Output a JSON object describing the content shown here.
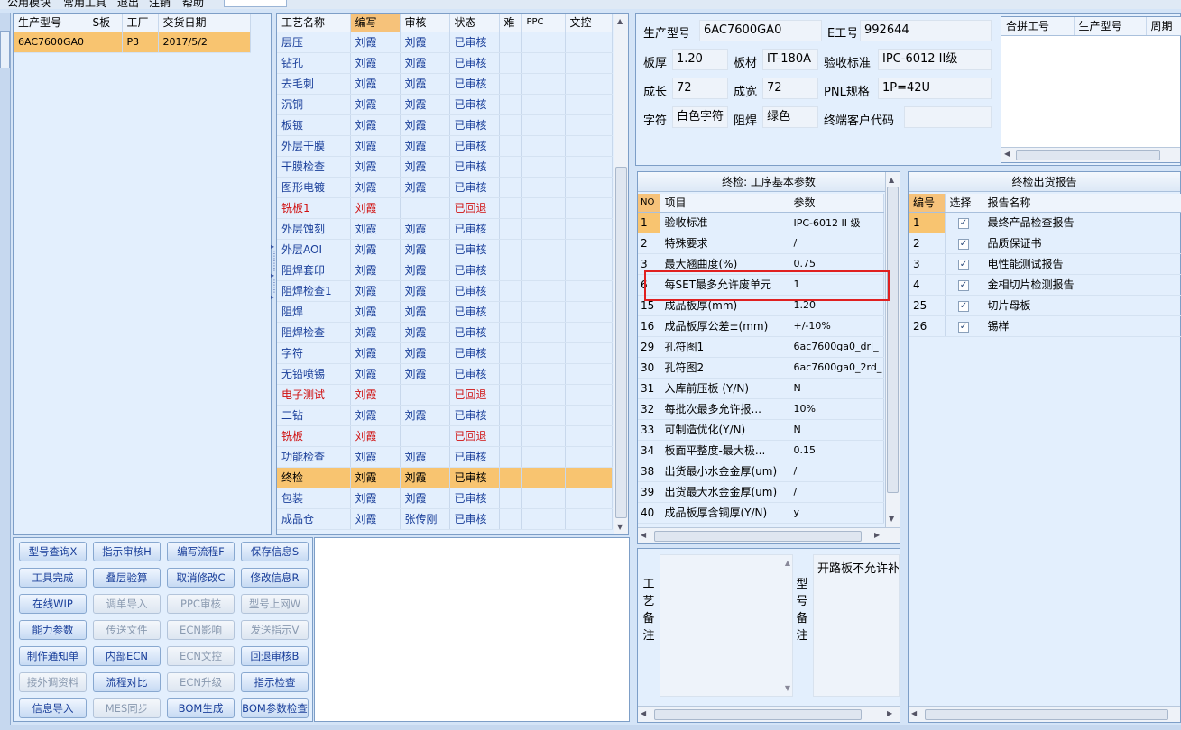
{
  "menu": {
    "items": [
      "公用模块",
      "常用工具",
      "退出",
      "注销",
      "帮助"
    ]
  },
  "left": {
    "headers": [
      "生产型号",
      "S板",
      "工厂",
      "交货日期"
    ],
    "rows": [
      [
        "6AC7600GA0",
        "",
        "P3",
        "2017/5/2"
      ]
    ]
  },
  "process": {
    "headers": [
      "工艺名称",
      "编写",
      "审核",
      "状态",
      "难",
      "PPC",
      "文控"
    ],
    "rows": [
      [
        "层压",
        "刘霞",
        "刘霞",
        "已审核",
        "blue"
      ],
      [
        "钻孔",
        "刘霞",
        "刘霞",
        "已审核",
        "blue"
      ],
      [
        "去毛刺",
        "刘霞",
        "刘霞",
        "已审核",
        "blue"
      ],
      [
        "沉铜",
        "刘霞",
        "刘霞",
        "已审核",
        "blue"
      ],
      [
        "板镀",
        "刘霞",
        "刘霞",
        "已审核",
        "blue"
      ],
      [
        "外层干膜",
        "刘霞",
        "刘霞",
        "已审核",
        "blue"
      ],
      [
        "干膜检查",
        "刘霞",
        "刘霞",
        "已审核",
        "blue"
      ],
      [
        "图形电镀",
        "刘霞",
        "刘霞",
        "已审核",
        "blue"
      ],
      [
        "铣板1",
        "刘霞",
        "",
        "已回退",
        "red"
      ],
      [
        "外层蚀刻",
        "刘霞",
        "刘霞",
        "已审核",
        "blue"
      ],
      [
        "外层AOI",
        "刘霞",
        "刘霞",
        "已审核",
        "blue"
      ],
      [
        "阻焊套印",
        "刘霞",
        "刘霞",
        "已审核",
        "blue"
      ],
      [
        "阻焊检查1",
        "刘霞",
        "刘霞",
        "已审核",
        "blue"
      ],
      [
        "阻焊",
        "刘霞",
        "刘霞",
        "已审核",
        "blue"
      ],
      [
        "阻焊检查",
        "刘霞",
        "刘霞",
        "已审核",
        "blue"
      ],
      [
        "字符",
        "刘霞",
        "刘霞",
        "已审核",
        "blue"
      ],
      [
        "无铅喷锡",
        "刘霞",
        "刘霞",
        "已审核",
        "blue"
      ],
      [
        "电子测试",
        "刘霞",
        "",
        "已回退",
        "red"
      ],
      [
        "二钻",
        "刘霞",
        "刘霞",
        "已审核",
        "blue"
      ],
      [
        "铣板",
        "刘霞",
        "",
        "已回退",
        "red"
      ],
      [
        "功能检查",
        "刘霞",
        "刘霞",
        "已审核",
        "blue"
      ],
      [
        "终检",
        "刘霞",
        "刘霞",
        "已审核",
        "sel"
      ],
      [
        "包装",
        "刘霞",
        "刘霞",
        "已审核",
        "blue"
      ],
      [
        "成品仓",
        "刘霞",
        "张传刚",
        "已审核",
        "blue"
      ]
    ]
  },
  "buttons": [
    [
      "型号查询X",
      "btn"
    ],
    [
      "指示审核H",
      "btn"
    ],
    [
      "编写流程F",
      "btn"
    ],
    [
      "保存信息S",
      "btn"
    ],
    [
      "工具完成",
      "btn"
    ],
    [
      "叠层验算",
      "btn"
    ],
    [
      "取消修改C",
      "btn"
    ],
    [
      "修改信息R",
      "btn"
    ],
    [
      "在线WIP",
      "btn"
    ],
    [
      "调单导入",
      "dis"
    ],
    [
      "PPC审核",
      "dis"
    ],
    [
      "型号上网W",
      "dis"
    ],
    [
      "能力参数",
      "btn"
    ],
    [
      "传送文件",
      "dis"
    ],
    [
      "ECN影响",
      "dis"
    ],
    [
      "发送指示V",
      "dis"
    ],
    [
      "制作通知单",
      "btn"
    ],
    [
      "内部ECN",
      "btn"
    ],
    [
      "ECN文控",
      "dis"
    ],
    [
      "回退审核B",
      "btn"
    ],
    [
      "接外调资料",
      "dis"
    ],
    [
      "流程对比",
      "btn"
    ],
    [
      "ECN升级",
      "dis"
    ],
    [
      "指示检查",
      "btn"
    ],
    [
      "信息导入",
      "btn"
    ],
    [
      "MES同步",
      "dis"
    ],
    [
      "BOM生成",
      "btn"
    ],
    [
      "BOM参数检查",
      "btn"
    ]
  ],
  "info": {
    "model_label": "生产型号",
    "model": "6AC7600GA0",
    "e_label": "E工号",
    "e_no": "992644",
    "thick_label": "板厚",
    "thick": "1.20",
    "mat_label": "板材",
    "mat": "IT-180A",
    "std_label": "验收标准",
    "std": "IPC-6012 II级",
    "len_label": "成长",
    "len": "72",
    "wid_label": "成宽",
    "wid": "72",
    "pnl_label": "PNL规格",
    "pnl": "1P=42U",
    "char_label": "字符",
    "char": "白色字符",
    "mask_label": "阻焊",
    "mask": "绿色",
    "cust_label": "终端客户代码",
    "cust": ""
  },
  "merge": {
    "headers": [
      "合拼工号",
      "生产型号",
      "周期"
    ]
  },
  "params": {
    "title": "终检: 工序基本参数",
    "headers": [
      "NO",
      "项目",
      "参数"
    ],
    "rows": [
      [
        "1",
        "验收标准",
        "IPC-6012 II 级"
      ],
      [
        "2",
        "特殊要求",
        "/"
      ],
      [
        "3",
        "最大翘曲度(%)",
        "0.75"
      ],
      [
        "6",
        "每SET最多允许废单元",
        "1"
      ],
      [
        "15",
        "成品板厚(mm)",
        "1.20"
      ],
      [
        "16",
        "成品板厚公差±(mm)",
        "+/-10%"
      ],
      [
        "29",
        "孔符图1",
        "6ac7600ga0_drl_"
      ],
      [
        "30",
        "孔符图2",
        "6ac7600ga0_2rd_"
      ],
      [
        "31",
        "入库前压板 (Y/N)",
        "N"
      ],
      [
        "32",
        "每批次最多允许报...",
        "10%"
      ],
      [
        "33",
        "可制造优化(Y/N)",
        "N"
      ],
      [
        "34",
        "板面平整度-最大极...",
        "0.15"
      ],
      [
        "38",
        "出货最小水金金厚(um)",
        "/"
      ],
      [
        "39",
        "出货最大水金金厚(um)",
        "/"
      ],
      [
        "40",
        "成品板厚含铜厚(Y/N)",
        "y"
      ]
    ]
  },
  "report": {
    "title": "终检出货报告",
    "headers": [
      "编号",
      "选择",
      "报告名称"
    ],
    "rows": [
      [
        "1",
        "最终产品检查报告"
      ],
      [
        "2",
        "品质保证书"
      ],
      [
        "3",
        "电性能测试报告"
      ],
      [
        "4",
        "金相切片检测报告"
      ],
      [
        "25",
        "切片母板"
      ],
      [
        "26",
        "锡样"
      ]
    ]
  },
  "notes": {
    "proc_label": "工艺备注",
    "model_label": "型号备注",
    "model_text": "开路板不允许补"
  }
}
